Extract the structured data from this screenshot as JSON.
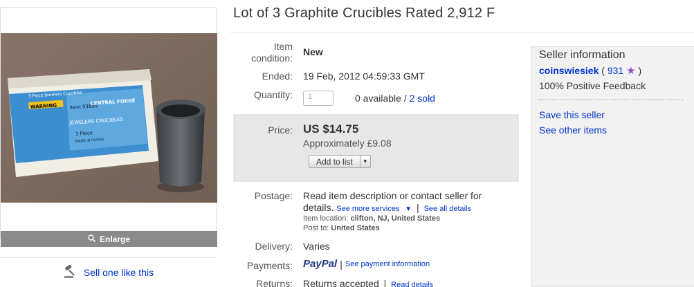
{
  "title": "Lot of 3 Graphite Crucibles Rated 2,912 F",
  "image": {
    "enlarge_label": "Enlarge",
    "package_lines": [
      "3 Piece Jewelers Crucibles",
      "WARNING",
      "JEWELERS CRUCIBLES",
      "3 Piece",
      "MADE IN RUSSIA",
      "Item 93699",
      "CENTRAL FORGE"
    ]
  },
  "sell_one_label": "Sell one like this",
  "details": {
    "condition_label": "Item condition:",
    "condition_value": "New",
    "ended_label": "Ended:",
    "ended_value": "19 Feb, 2012 04:59:33 GMT",
    "quantity_label": "Quantity:",
    "quantity_value": "1",
    "available_text": "0 available /",
    "sold_link": "2 sold",
    "price_label": "Price:",
    "price_value": "US $14.75",
    "approx_value": "Approximately £9.08",
    "add_to_list": "Add to list",
    "postage_label": "Postage:",
    "postage_text_1": "Read item description or contact seller for",
    "postage_text_2": "details.",
    "see_more_services": "See more services",
    "see_all_details": "See all details",
    "item_location_label": "Item location:",
    "item_location_value": "clifton, NJ, United States",
    "post_to_label": "Post to:",
    "post_to_value": "United States",
    "delivery_label": "Delivery:",
    "delivery_value": "Varies",
    "payments_label": "Payments:",
    "paypal_label": "PayPal",
    "payment_info_link": "See payment information",
    "returns_label": "Returns:",
    "returns_value": "Returns accepted",
    "returns_link": "Read details"
  },
  "seller": {
    "heading": "Seller information",
    "name": "coinswiesiek",
    "score_open": "(",
    "score": "931",
    "score_close": ")",
    "feedback": "100% Positive Feedback",
    "save_seller": "Save this seller",
    "see_other_items": "See other items"
  },
  "colors": {
    "link": "#0033cc",
    "price_bg": "#e7e7e7",
    "enlarge_bg": "#8a8a8a",
    "paypal_dark": "#253b80",
    "paypal_light": "#179bd7"
  }
}
